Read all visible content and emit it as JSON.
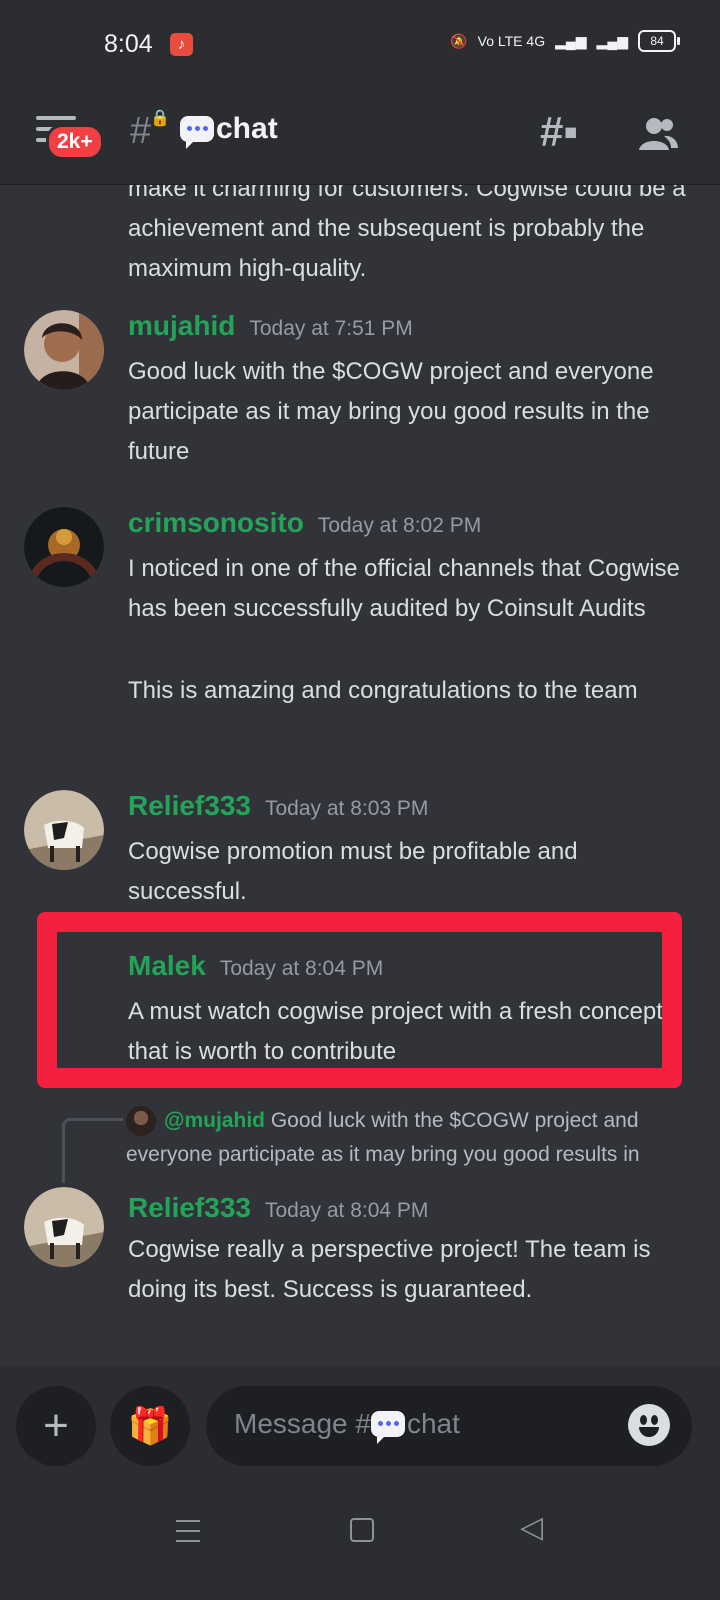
{
  "status_bar": {
    "time": "8:04",
    "network_labels": "Vo LTE 4G",
    "battery": "84"
  },
  "header": {
    "badge": "2k+",
    "channel_name": "chat"
  },
  "messages": [
    {
      "partial_text": "make it charming for customers. Cogwise could be a achievement and the subsequent is probably the maximum high-quality."
    },
    {
      "author": "mujahid",
      "timestamp": "Today at 7:51 PM",
      "text": "Good luck with the $COGW project and everyone participate as it may bring you good results in the future"
    },
    {
      "author": "crimsonosito",
      "timestamp": "Today at 8:02 PM",
      "text": "I noticed in one of the official channels that Cogwise has been  successfully audited by Coinsult Audits",
      "text2": "This is amazing and congratulations to the team"
    },
    {
      "author": "Relief333",
      "timestamp": "Today at 8:03 PM",
      "text": "Cogwise promotion must be profitable and successful."
    },
    {
      "author": "Malek",
      "timestamp": "Today at 8:04 PM",
      "text": "A must watch cogwise project with a fresh concept that is worth to contribute"
    },
    {
      "reply_mention": "@mujahid",
      "reply_text": "Good luck with the $COGW project and everyone participate as it may bring you good results in",
      "author": "Relief333",
      "timestamp": "Today at 8:04 PM",
      "text": "Cogwise really a perspective project! The team is doing its best. Success is guaranteed."
    }
  ],
  "composer": {
    "placeholder_prefix": "Message #",
    "placeholder_channel": "chat"
  },
  "colors": {
    "username": "#23a559",
    "highlight": "#f5203e",
    "background": "#313338"
  }
}
